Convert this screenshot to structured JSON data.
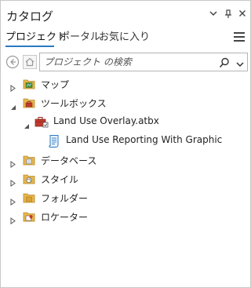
{
  "panel": {
    "title": "カタログ",
    "title_buttons": [
      "chevron-down-icon",
      "pin-icon",
      "close-icon"
    ]
  },
  "tabs": [
    {
      "label": "プロジェクト",
      "active": true
    },
    {
      "label": "ポータル",
      "active": false
    },
    {
      "label": "お気に入り",
      "active": false
    }
  ],
  "search": {
    "placeholder": "プロジェクト の検索",
    "value": ""
  },
  "tree": {
    "items": [
      {
        "label": "マップ",
        "icon": "maps-folder-icon",
        "expanded": false
      },
      {
        "label": "ツールボックス",
        "icon": "toolbox-folder-icon",
        "expanded": true
      },
      {
        "label": "Land Use Overlay.atbx",
        "icon": "toolbox-icon",
        "expanded": true
      },
      {
        "label": "Land Use Reporting With Graphic",
        "icon": "script-tool-icon",
        "expanded": null
      },
      {
        "label": "データベース",
        "icon": "database-folder-icon",
        "expanded": false
      },
      {
        "label": "スタイル",
        "icon": "styles-folder-icon",
        "expanded": false
      },
      {
        "label": "フォルダー",
        "icon": "folder-icon",
        "expanded": false
      },
      {
        "label": "ロケーター",
        "icon": "locators-folder-icon",
        "expanded": false
      }
    ]
  },
  "colors": {
    "accent": "#2b79c2",
    "folder": "#e8b84a",
    "toolbox_red": "#c0392b"
  }
}
